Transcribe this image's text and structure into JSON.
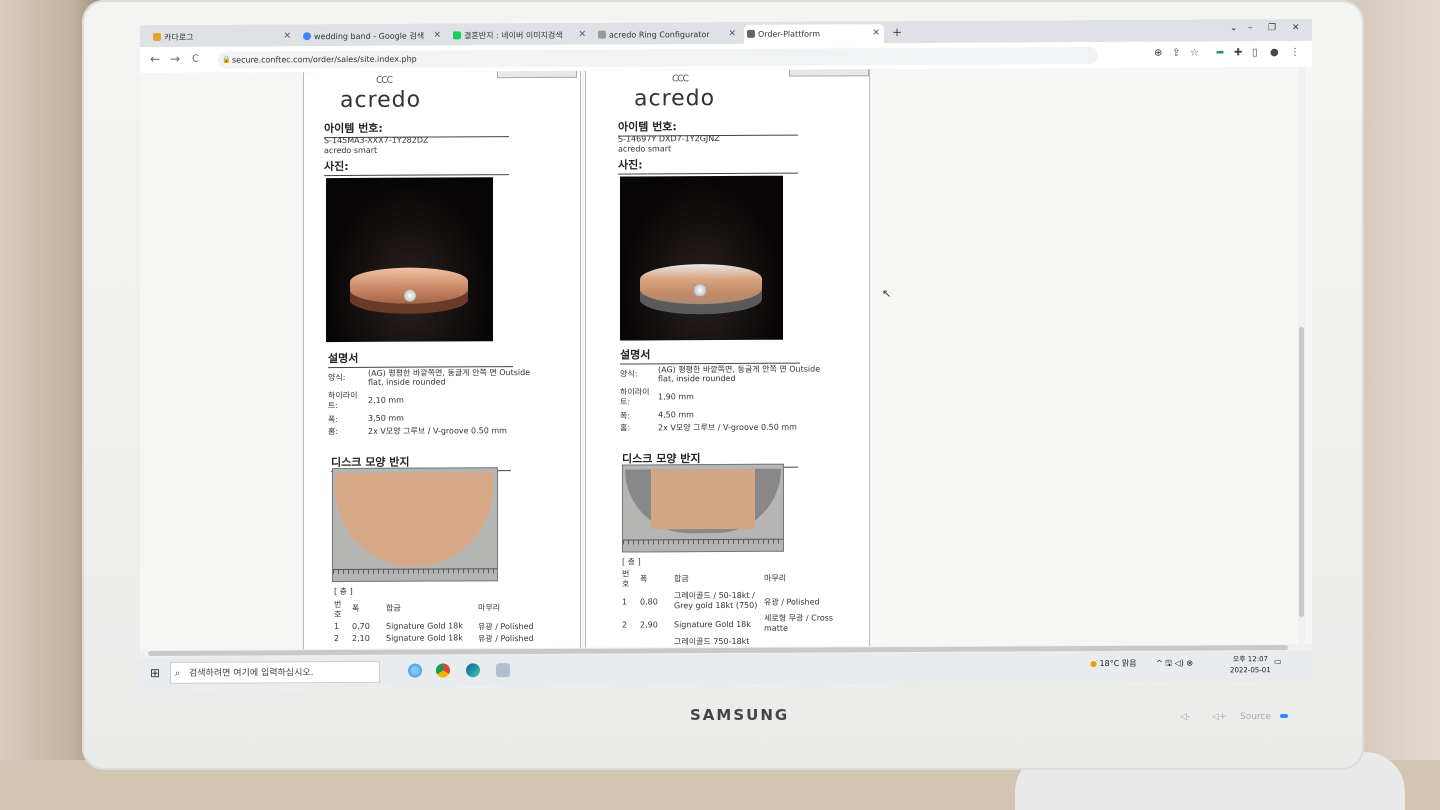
{
  "browser": {
    "tabs": [
      {
        "title": "카다로그",
        "color": "#e7a22b"
      },
      {
        "title": "wedding band - Google 검색",
        "color": "#4285f4"
      },
      {
        "title": "결혼반지 : 네이버 이미지검색",
        "color": "#19ce60"
      },
      {
        "title": "acredo Ring Configurator",
        "color": "#777777"
      },
      {
        "title": "Order-Plattform",
        "color": "#666666",
        "active": true
      }
    ],
    "new_tab": "+",
    "window_controls": [
      "⌄",
      "–",
      "❐",
      "✕"
    ],
    "nav": {
      "back": "←",
      "forward": "→",
      "reload": "C"
    },
    "url": "secure.conftec.com/order/sales/site.index.php"
  },
  "products": [
    {
      "logo_mark": "CCC",
      "logo": "acredo",
      "item_no_label": "아이템 번호:",
      "item_no": "S-145MA3-XXX7-1Y282DZ",
      "line": "acredo smart",
      "photo_label": "사진:",
      "ring_color": "#d79a78",
      "description_label": "설명서",
      "specs": [
        {
          "k": "양식:",
          "v": "(AG) 평평한 바깥쪽면, 둥글게 안쪽 면 Outside",
          "v2": "flat, inside rounded"
        },
        {
          "k": "하이라이",
          "k2": "트:",
          "v": "2,10 mm"
        },
        {
          "k": "폭:",
          "v": "3,50 mm"
        },
        {
          "k": "홈:",
          "v": "2x V모양 그루브 / V-groove 0.50 mm"
        }
      ],
      "disc_label": "디스크 모양 반지",
      "layers_label": "[ 층 ]",
      "table_headers": [
        "번",
        "폭",
        "합금",
        "마무리"
      ],
      "table_header_sub": "호",
      "rows": [
        [
          "1",
          "0,70",
          "Signature Gold 18k",
          "유광 / Polished"
        ],
        [
          "2",
          "2,10",
          "Signature Gold 18k",
          "유광 / Polished"
        ]
      ]
    },
    {
      "logo_mark": "CCC",
      "logo": "acredo",
      "item_no_label": "아이템 번호:",
      "item_no": "S-14697Y DXD7-1Y2GJNZ",
      "line": "acredo smart",
      "photo_label": "사진:",
      "ring_color": "#c8936d",
      "description_label": "설명서",
      "specs": [
        {
          "k": "양식:",
          "v": "(AG) 평평한 바깥쪽면, 둥글게 안쪽 면 Outside",
          "v2": "flat, inside rounded"
        },
        {
          "k": "하이라이",
          "k2": "트:",
          "v": "1,90 mm"
        },
        {
          "k": "폭:",
          "v": "4,50 mm"
        },
        {
          "k": "홈:",
          "v": "2x V모양 그루브 / V-groove 0.50 mm"
        }
      ],
      "disc_label": "디스크 모양 반지",
      "layers_label": "[ 층 ]",
      "table_headers": [
        "번",
        "폭",
        "합금",
        "마무리"
      ],
      "table_header_sub": "호",
      "rows": [
        [
          "1",
          "0,80",
          "그레이골드 / 50-18kt / Grey gold 18kt (750)",
          "유광 / Polished"
        ],
        [
          "2",
          "2,90",
          "Signature Gold 18k",
          "세로형 무광 / Cross matte"
        ],
        [
          "",
          "",
          "그레이골드 750-18kt",
          ""
        ]
      ]
    }
  ],
  "taskbar": {
    "search_placeholder": "검색하려면 여기에 입력하십시오.",
    "weather": "18°C 맑음",
    "tray_icons": "^ 🖫 ◁) ⊗",
    "time": "오후 12:07",
    "date": "2022-05-01"
  },
  "monitor": {
    "brand": "SAMSUNG",
    "source_label": "Source"
  }
}
